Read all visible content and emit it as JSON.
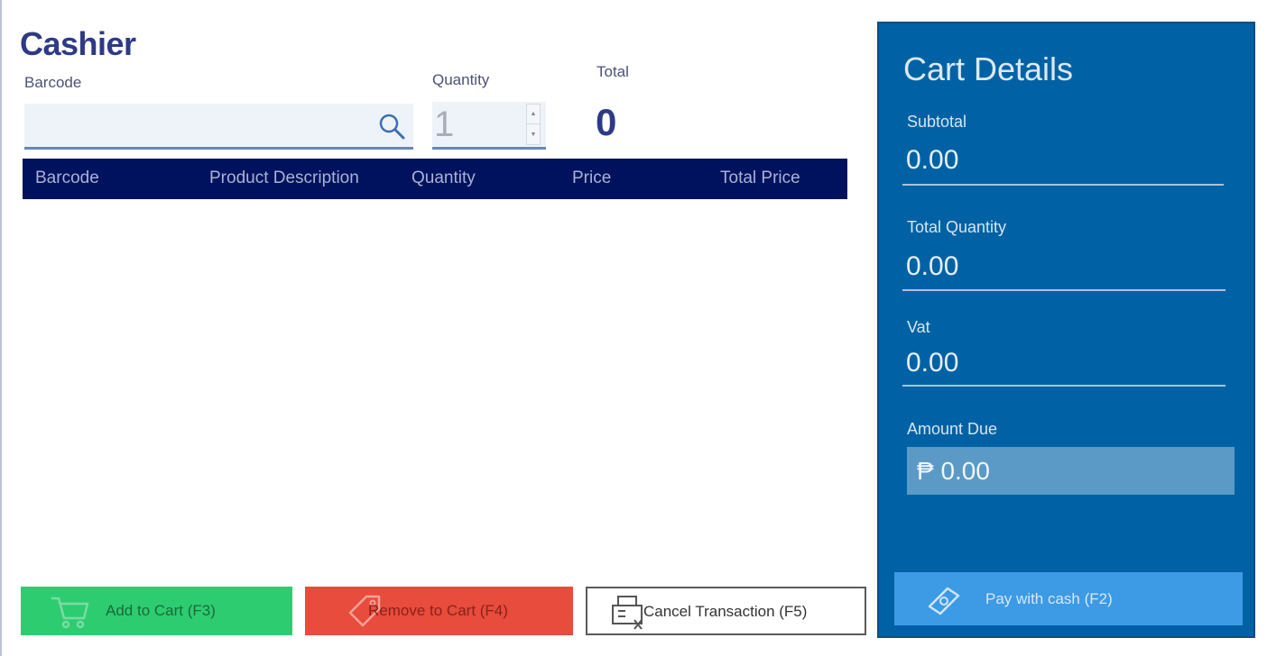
{
  "title": "Cashier",
  "barcode": {
    "label": "Barcode",
    "value": "",
    "placeholder": ""
  },
  "quantity": {
    "label": "Quantity",
    "value": "1"
  },
  "total": {
    "label": "Total",
    "value": "0"
  },
  "grid": {
    "columns": [
      "Barcode",
      "Product Description",
      "Quantity",
      "Price",
      "Total Price"
    ],
    "rows": []
  },
  "buttons": {
    "add": "Add to Cart (F3)",
    "remove": "Remove to Cart (F4)",
    "cancel": "Cancel Transaction (F5)"
  },
  "cart": {
    "title": "Cart Details",
    "subtotal_label": "Subtotal",
    "subtotal_value": "0.00",
    "total_qty_label": "Total Quantity",
    "total_qty_value": "0.00",
    "vat_label": "Vat",
    "vat_value": "0.00",
    "amount_due_label": "Amount Due",
    "amount_due_value": "₱ 0.00",
    "pay_button": "Pay with cash (F2)"
  },
  "colors": {
    "header_bg": "#00125e",
    "panel_bg": "#0062a4",
    "add_button": "#2ecc71",
    "remove_button": "#e74c3c",
    "pay_button": "#3d9ae4"
  },
  "icons": {
    "search": "search-icon",
    "add": "cart-icon",
    "remove": "tag-icon",
    "cancel": "register-icon",
    "pay": "money-icon"
  }
}
